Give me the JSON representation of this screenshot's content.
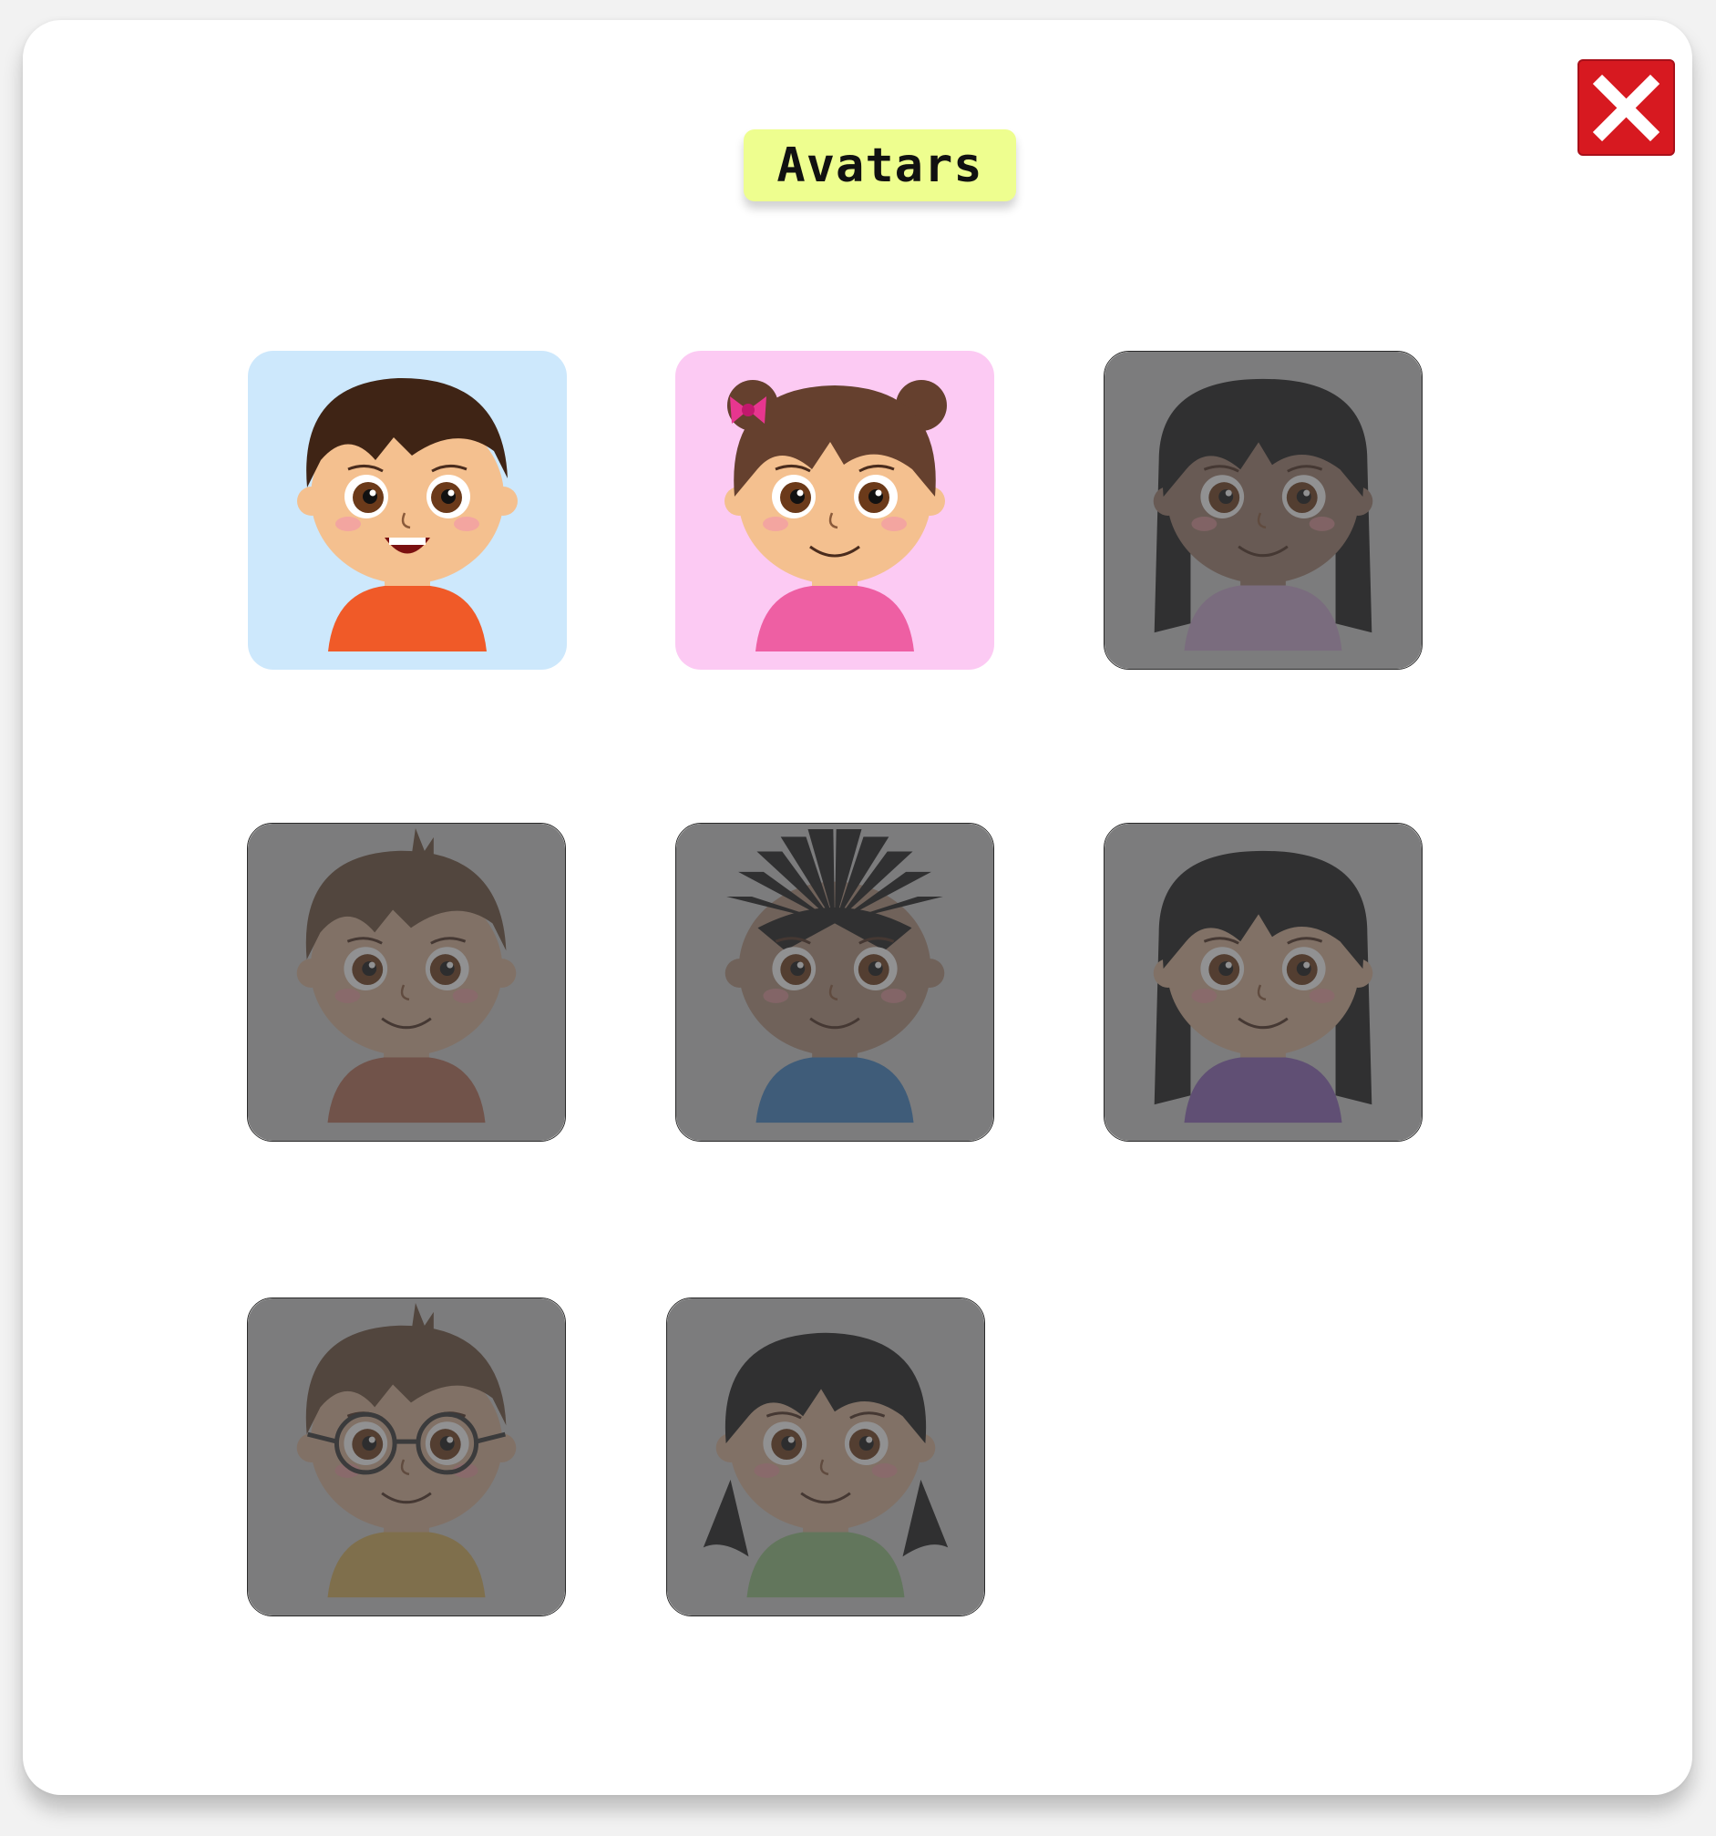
{
  "dialog": {
    "title": "Avatars",
    "close_icon": "close-icon"
  },
  "colors": {
    "title_background": "#eefe8f",
    "close_button": "#d71920",
    "panel": "#ffffff",
    "locked_overlay": "#424244"
  },
  "avatars": [
    {
      "id": "boy-red-shirt",
      "background": "#cde8fc",
      "locked": false,
      "skin": "#f4c08f",
      "hair": "#3f2415",
      "shirt": "#f05a28",
      "style": "boy-short"
    },
    {
      "id": "girl-pigtails-bow",
      "background": "#fccaf3",
      "locked": false,
      "skin": "#f4c08f",
      "hair": "#65402e",
      "shirt": "#ee5fa3",
      "style": "girl-buns"
    },
    {
      "id": "girl-long-hair-dark",
      "background": "#cccccc",
      "locked": true,
      "skin": "#9e7d6b",
      "hair": "#1a1a1a",
      "shirt": "#c9a7cf",
      "style": "girl-long"
    },
    {
      "id": "boy-spiky",
      "background": "#cccccc",
      "locked": true,
      "skin": "#d9b496",
      "hair": "#6a4d37",
      "shirt": "#b46b55",
      "style": "boy-spiky"
    },
    {
      "id": "boy-afro-spiky",
      "background": "#cccccc",
      "locked": true,
      "skin": "#b0907b",
      "hair": "#1a1a1a",
      "shirt": "#3c82c4",
      "style": "boy-afro"
    },
    {
      "id": "girl-long-hair-smile",
      "background": "#cccccc",
      "locked": true,
      "skin": "#d9b496",
      "hair": "#1a1a1a",
      "shirt": "#8a62b8",
      "style": "girl-long"
    },
    {
      "id": "boy-glasses",
      "background": "#cccccc",
      "locked": true,
      "skin": "#d9b496",
      "hair": "#6a4d37",
      "shirt": "#d4ae5a",
      "style": "boy-glasses"
    },
    {
      "id": "girl-pigtails-dark",
      "background": "#cccccc",
      "locked": true,
      "skin": "#d9b496",
      "hair": "#1a1a1a",
      "shirt": "#8fbf7e",
      "style": "girl-pigtails"
    }
  ]
}
